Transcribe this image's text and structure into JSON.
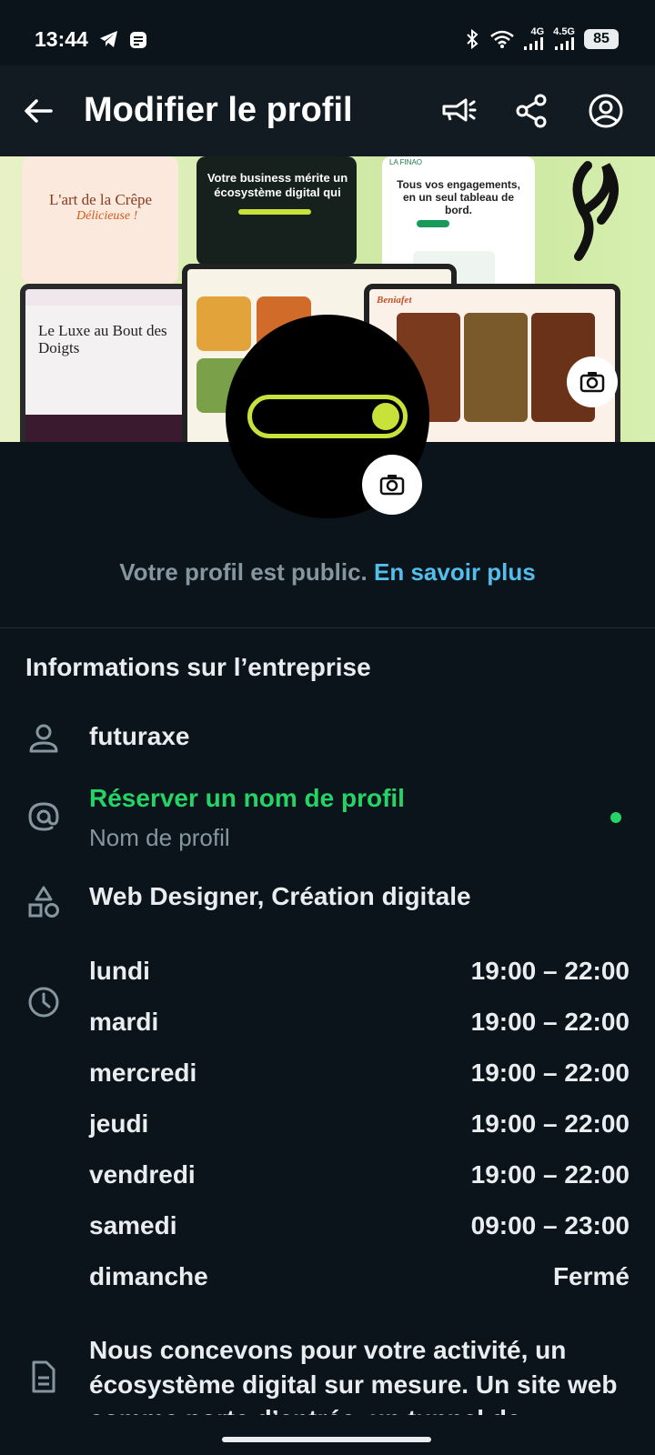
{
  "status": {
    "time": "13:44",
    "net1": "4G",
    "net2": "4.5G",
    "battery": "85"
  },
  "appbar": {
    "title": "Modifier le profil",
    "icons": [
      "back-arrow-icon",
      "megaphone-icon",
      "share-icon",
      "account-circle-icon"
    ]
  },
  "cover": {
    "mock1_title": "L'art de la Crêpe",
    "mock1_sub": "Délicieuse !",
    "mock2_title": "Votre business mérite un écosystème digital qui",
    "mock3_title": "Tous vos engagements, en un seul tableau de bord.",
    "mock3_brand": "LA FINAO",
    "mock4_title": "Le Luxe au Bout des Doigts",
    "mock6_brand": "Beniafet"
  },
  "profile": {
    "public_text": "Votre profil est public.",
    "public_link": "En savoir plus"
  },
  "business": {
    "section_title": "Informations sur l’entreprise",
    "name": "futuraxe",
    "reserve_label": "Réserver un nom de profil",
    "reserve_sub": "Nom de profil",
    "category": "Web Designer, Création digitale",
    "hours": [
      {
        "day": "lundi",
        "time": "19:00 – 22:00"
      },
      {
        "day": "mardi",
        "time": "19:00 – 22:00"
      },
      {
        "day": "mercredi",
        "time": "19:00 – 22:00"
      },
      {
        "day": "jeudi",
        "time": "19:00 – 22:00"
      },
      {
        "day": "vendredi",
        "time": "19:00 – 22:00"
      },
      {
        "day": "samedi",
        "time": "09:00 – 23:00"
      },
      {
        "day": "dimanche",
        "time": "Fermé"
      }
    ],
    "about": "Nous concevons pour votre activité, un écosystème digital sur mesure. Un site web comme porte d’entrée, un tunnel de"
  },
  "colors": {
    "background": "#0b141a",
    "appbar": "#111b21",
    "accent_green": "#25d366",
    "link_blue": "#53bdeb",
    "toggle_lime": "#c8e23a"
  }
}
